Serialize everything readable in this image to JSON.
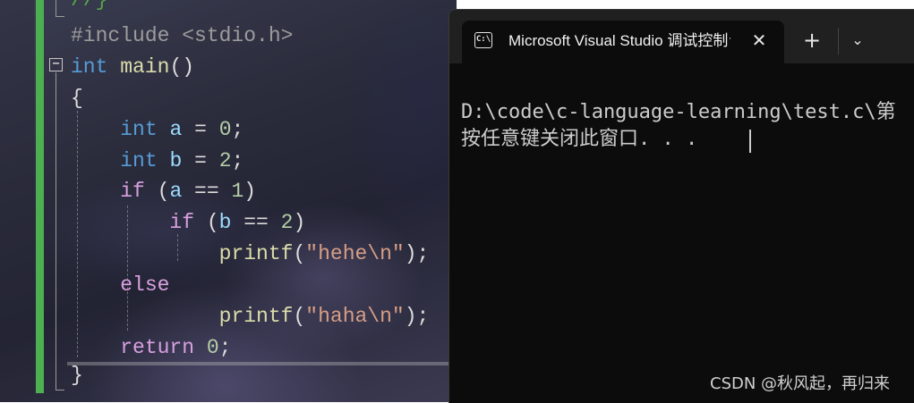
{
  "editor": {
    "lines": [
      {
        "parts": [
          [
            "cmt",
            "//}"
          ]
        ]
      },
      {
        "parts": [
          [
            "pre",
            "#include <stdio.h>"
          ]
        ]
      },
      {
        "parts": [
          [
            "kw",
            "int"
          ],
          [
            "punc",
            " "
          ],
          [
            "fn",
            "main"
          ],
          [
            "punc",
            "()"
          ]
        ]
      },
      {
        "parts": [
          [
            "punc",
            "{"
          ]
        ]
      },
      {
        "parts": [
          [
            "punc",
            "    "
          ],
          [
            "kw",
            "int"
          ],
          [
            "punc",
            " "
          ],
          [
            "var",
            "a"
          ],
          [
            "punc",
            " = "
          ],
          [
            "num",
            "0"
          ],
          [
            "punc",
            ";"
          ]
        ]
      },
      {
        "parts": [
          [
            "punc",
            "    "
          ],
          [
            "kw",
            "int"
          ],
          [
            "punc",
            " "
          ],
          [
            "var",
            "b"
          ],
          [
            "punc",
            " = "
          ],
          [
            "num",
            "2"
          ],
          [
            "punc",
            ";"
          ]
        ]
      },
      {
        "parts": [
          [
            "punc",
            "    "
          ],
          [
            "ctl",
            "if"
          ],
          [
            "punc",
            " ("
          ],
          [
            "var",
            "a"
          ],
          [
            "punc",
            " == "
          ],
          [
            "num",
            "1"
          ],
          [
            "punc",
            ")"
          ]
        ]
      },
      {
        "parts": [
          [
            "punc",
            "        "
          ],
          [
            "ctl",
            "if"
          ],
          [
            "punc",
            " ("
          ],
          [
            "var",
            "b"
          ],
          [
            "punc",
            " == "
          ],
          [
            "num",
            "2"
          ],
          [
            "punc",
            ")"
          ]
        ]
      },
      {
        "parts": [
          [
            "punc",
            "            "
          ],
          [
            "fn",
            "printf"
          ],
          [
            "punc",
            "("
          ],
          [
            "str",
            "\"hehe\\n\""
          ],
          [
            "punc",
            ");"
          ]
        ]
      },
      {
        "parts": [
          [
            "punc",
            "    "
          ],
          [
            "ctl",
            "else"
          ]
        ]
      },
      {
        "parts": [
          [
            "punc",
            "            "
          ],
          [
            "fn",
            "printf"
          ],
          [
            "punc",
            "("
          ],
          [
            "str",
            "\"haha\\n\""
          ],
          [
            "punc",
            ");"
          ]
        ]
      },
      {
        "parts": [
          [
            "punc",
            "    "
          ],
          [
            "ctl",
            "return"
          ],
          [
            "punc",
            " "
          ],
          [
            "num",
            "0"
          ],
          [
            "punc",
            ";"
          ]
        ]
      },
      {
        "parts": [
          [
            "punc",
            "}"
          ]
        ]
      }
    ],
    "fold_symbol": "−"
  },
  "terminal": {
    "tab_icon": "C:\\",
    "tab_title": "Microsoft Visual Studio 调试控制台",
    "close_glyph": "✕",
    "new_tab_glyph": "+",
    "dropdown_glyph": "⌄",
    "lines": [
      "D:\\code\\c-language-learning\\test.c\\第",
      "按任意键关闭此窗口. . ."
    ]
  },
  "watermark": "CSDN @秋风起，再归来",
  "colors": {
    "keyword": "#569cd6",
    "control": "#d8a0df",
    "variable": "#9cdcfe",
    "function": "#dcdcaa",
    "number": "#b5cea8",
    "string": "#d69d85",
    "gutter_change": "#4caf50",
    "terminal_bg": "#0c0c0c"
  }
}
